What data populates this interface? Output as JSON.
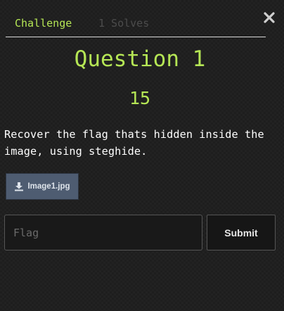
{
  "tabs": [
    {
      "label": "Challenge",
      "active": true
    },
    {
      "label": "1 Solves",
      "active": false
    }
  ],
  "close": {
    "icon": "close-icon",
    "glyph": "✕"
  },
  "challenge": {
    "title": "Question 1",
    "points": "15",
    "description": "Recover the flag thats hidden inside the image, using steghide."
  },
  "file": {
    "label": "Image1.jpg",
    "icon": "download-icon"
  },
  "form": {
    "flag_value": "",
    "flag_placeholder": "Flag",
    "submit_label": "Submit"
  },
  "colors": {
    "accent": "#b5e655",
    "background": "#1e1e1e",
    "file_button": "#4e5c71",
    "inactive_tab": "#4c4c4c"
  }
}
